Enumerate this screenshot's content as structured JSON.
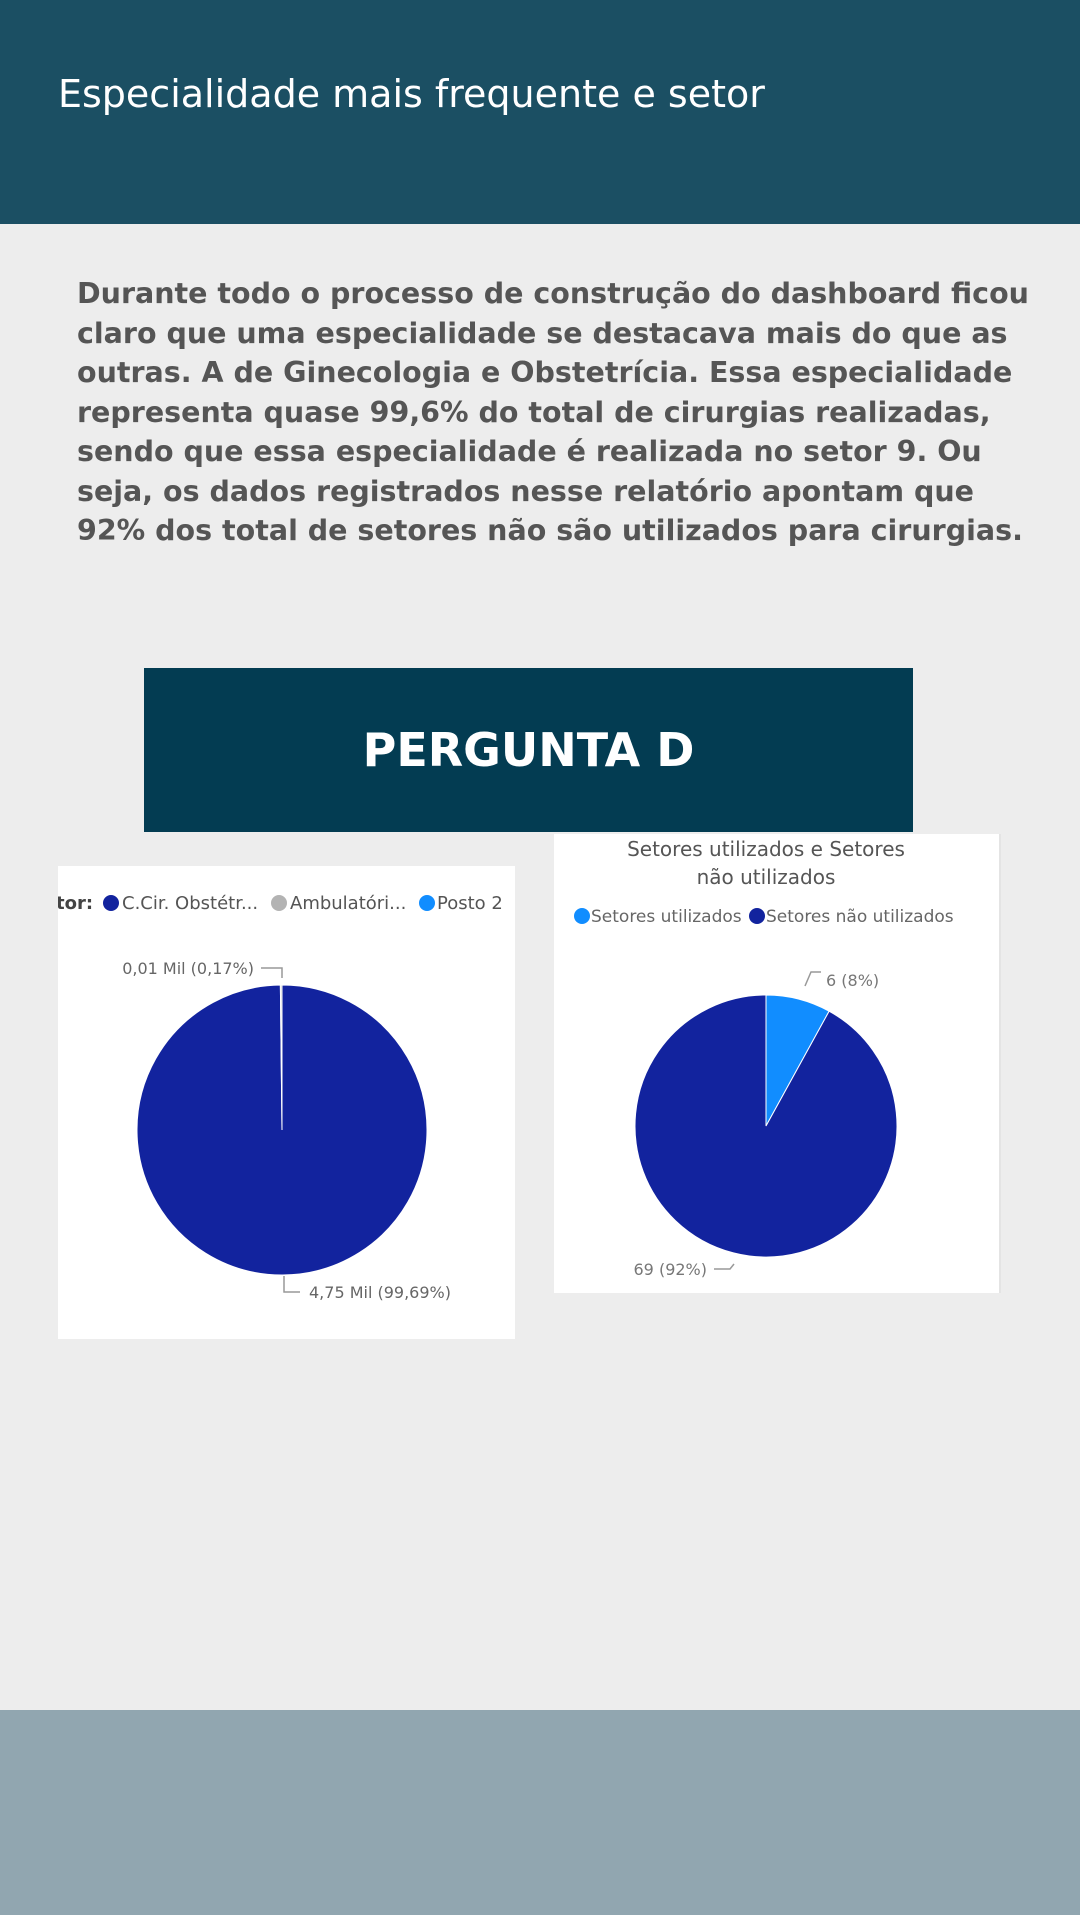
{
  "header": {
    "title": "Especialidade mais frequente e setor"
  },
  "intro_text": "Durante todo o processo de construção do dashboard ficou claro que uma especialidade se destacava mais do que as outras. A de Ginecologia e Obstetrícia. Essa especialidade representa quase 99,6% do total de cirurgias realizadas, sendo que essa especialidade é realizada no setor 9. Ou seja, os dados registrados nesse relatório apontam que 92% dos total de setores não são utilizados para cirurgias.",
  "section_title": "PERGUNTA D",
  "chart_data": [
    {
      "type": "pie",
      "title": "",
      "legend_title": "tor:",
      "legend_position": "top",
      "categories": [
        "C.Cir. Obstétr...",
        "Ambulatóri...",
        "Posto 2"
      ],
      "values": [
        4750,
        8,
        0.5
      ],
      "data_labels": [
        "4,75 Mil (99,69%)",
        "0,01 Mil (0,17%)",
        ""
      ],
      "colors": [
        "#12239e",
        "#b3b3b3",
        "#118dff"
      ]
    },
    {
      "type": "pie",
      "title": "Setores utilizados e Setores não utilizados",
      "legend_position": "top",
      "categories": [
        "Setores utilizados",
        "Setores não utilizados"
      ],
      "values": [
        6,
        69
      ],
      "data_labels": [
        "6 (8%)",
        "69 (92%)"
      ],
      "colors": [
        "#118dff",
        "#12239e"
      ]
    }
  ]
}
